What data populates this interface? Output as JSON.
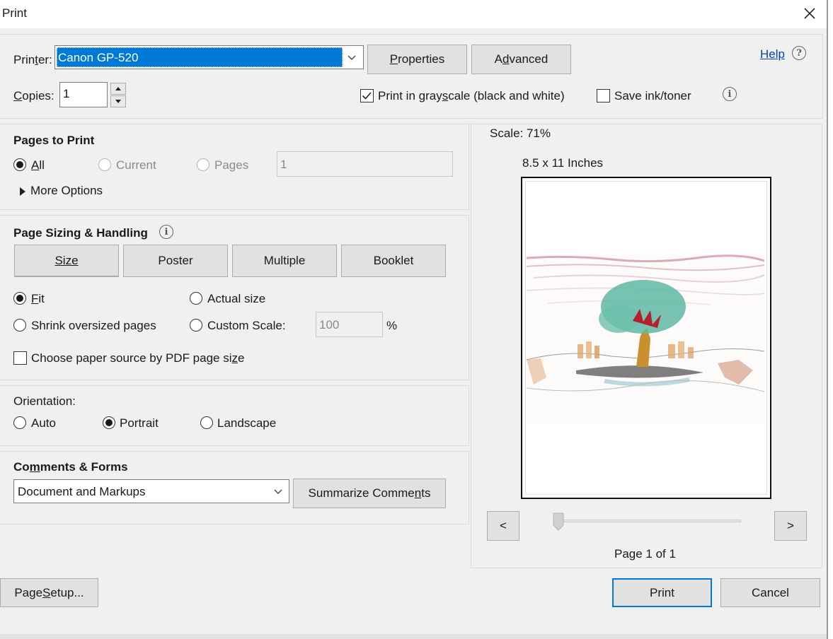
{
  "window": {
    "title": "Print"
  },
  "printer": {
    "label_pre": "Prin",
    "label_u": "t",
    "label_post": "er:",
    "selected": "Canon GP-520",
    "properties_pre": "",
    "properties_u": "P",
    "properties_post": "roperties",
    "advanced_pre": "A",
    "advanced_u": "d",
    "advanced_post": "vanced"
  },
  "help": {
    "label": "Help"
  },
  "copies": {
    "label_u": "C",
    "label_post": "opies:",
    "value": "1"
  },
  "grayscale": {
    "checked": true,
    "label_pre": "Print in gray",
    "label_u": "s",
    "label_post": "cale (black and white)"
  },
  "save_ink": {
    "checked": false,
    "label": "Save ink/toner"
  },
  "pages_to_print": {
    "heading": "Pages to Print",
    "all_u": "A",
    "all_post": "ll",
    "current": "Current",
    "pages": "Pages",
    "pages_value": "1",
    "more_options": "More Options"
  },
  "sizing": {
    "heading": "Page Sizing & Handling",
    "tabs": {
      "size": "Size",
      "poster": "Poster",
      "multiple": "Multiple",
      "booklet": "Booklet"
    },
    "fit_u": "F",
    "fit_post": "it",
    "actual_size": "Actual size",
    "shrink": "Shrink oversized pages",
    "custom_scale": "Custom Scale:",
    "custom_value": "100",
    "percent": "%",
    "paper_source_pre": "Choose paper source by PDF page si",
    "paper_source_u": "z",
    "paper_source_post": "e"
  },
  "orientation": {
    "heading": "Orientation:",
    "auto": "Auto",
    "portrait": "Portrait",
    "landscape": "Landscape",
    "selected": "portrait"
  },
  "comments": {
    "heading_pre": "Co",
    "heading_u": "m",
    "heading_post": "ments & Forms",
    "selected": "Document and Markups",
    "summarize_pre": "Summarize Comme",
    "summarize_u": "n",
    "summarize_post": "ts"
  },
  "preview": {
    "scale": "Scale:  71%",
    "paper_size": "8.5 x 11 Inches",
    "prev": "<",
    "next": ">",
    "page_of": "Page 1 of 1"
  },
  "footer": {
    "page_setup_pre": "Page ",
    "page_setup_u": "S",
    "page_setup_post": "etup...",
    "print": "Print",
    "cancel": "Cancel"
  },
  "colors": {
    "selection": "#0078d7",
    "primary_border": "#0078d7",
    "link": "#0645ad"
  }
}
